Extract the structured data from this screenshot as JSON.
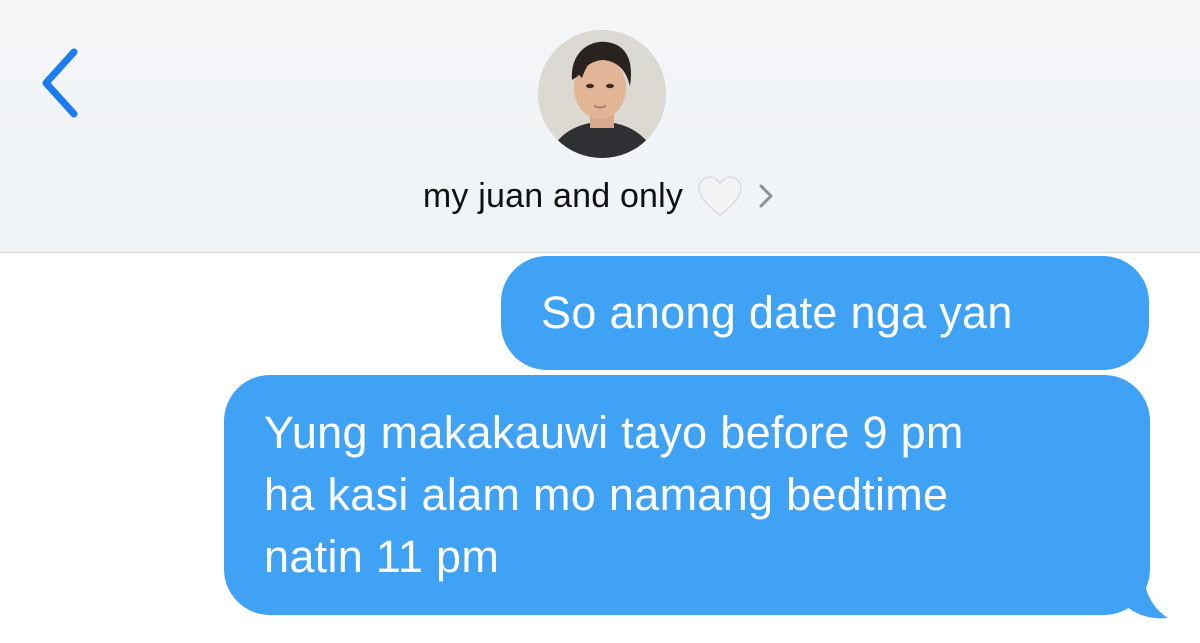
{
  "header": {
    "back_icon": "chevron-left-icon",
    "avatar_icon": "avatar-photo",
    "contact_name": "my juan and only",
    "heart_icon": "white-heart-icon",
    "chevron_icon": "chevron-right-icon"
  },
  "messages": [
    {
      "direction": "outgoing",
      "lines": [
        "So anong date nga yan"
      ]
    },
    {
      "direction": "outgoing",
      "lines": [
        "Yung makakauwi tayo before 9 pm",
        "ha kasi alam mo namang bedtime",
        "natin 11 pm"
      ]
    }
  ],
  "colors": {
    "accent": "#1a7cf0",
    "bubble": "#3fa2f5",
    "header_bg": "#f3f5f8"
  }
}
